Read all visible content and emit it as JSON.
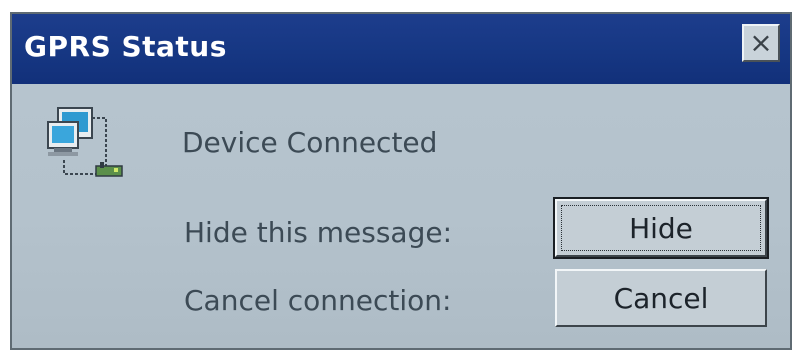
{
  "dialog": {
    "title": "GPRS Status",
    "close_symbol": "×",
    "icon": "network-connection-icon",
    "status_text": "Device Connected",
    "hide_label": "Hide this message:",
    "hide_button": "Hide",
    "cancel_label": "Cancel connection:",
    "cancel_button": "Cancel"
  },
  "colors": {
    "titlebar": "#163783",
    "body": "#b5c3cd",
    "text": "#3c4a55"
  }
}
